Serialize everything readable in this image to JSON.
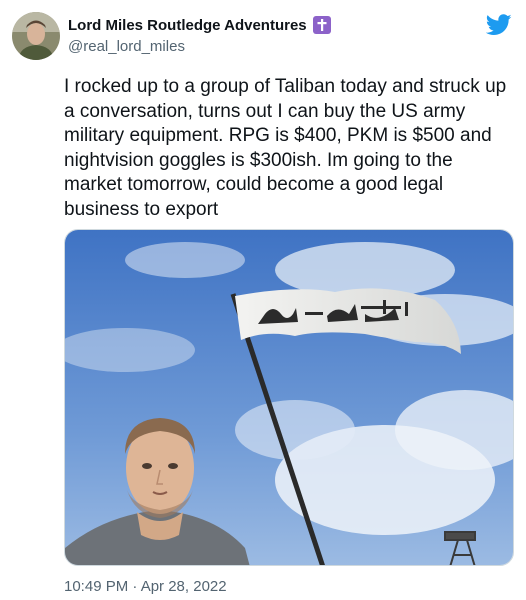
{
  "author": {
    "display_name": "Lord Miles Routledge Adventures",
    "handle": "@real_lord_miles",
    "badge_icon": "latin-cross-icon",
    "badge_color": "#8c62c9"
  },
  "tweet": {
    "text": "I rocked up to a group of Taliban today and struck up a conversation, turns out I can buy the US army military equipment. RPG is $400, PKM is $500 and nightvision goggles is $300ish. Im going to the market tomorrow, could become a good legal business to export",
    "timestamp": "10:49 PM · Apr 28, 2022"
  },
  "brand": {
    "icon": "twitter-bird-icon",
    "color": "#1d9bf0"
  }
}
